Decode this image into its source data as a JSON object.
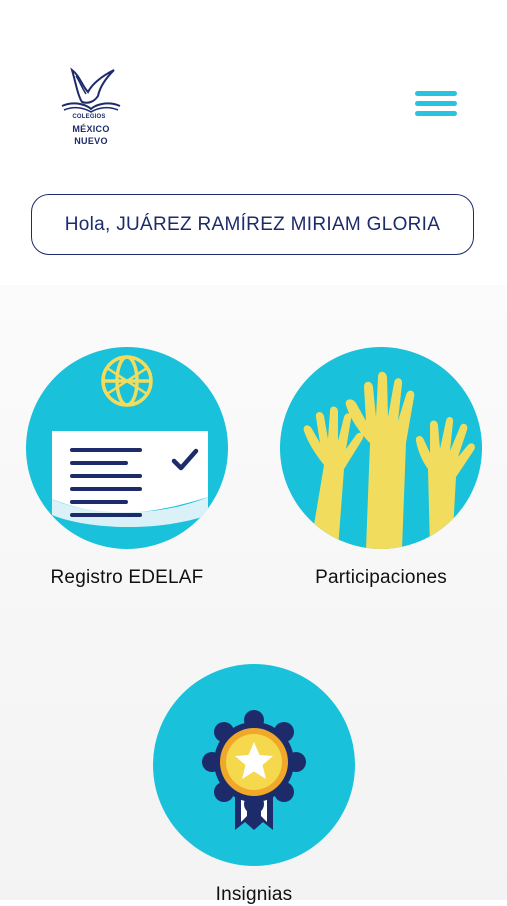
{
  "header": {
    "logo": {
      "small_text": "COLEGIOS",
      "line1": "MÉXICO",
      "line2": "NUEVO"
    },
    "menu_icon": "hamburger-menu-icon"
  },
  "greeting": {
    "text": "Hola, JUÁREZ RAMÍREZ MIRIAM GLORIA"
  },
  "tiles": [
    {
      "label": "Registro EDELAF",
      "icon": "registration-form-icon"
    },
    {
      "label": "Participaciones",
      "icon": "raised-hands-icon"
    },
    {
      "label": "Insignias",
      "icon": "badge-medal-icon"
    }
  ],
  "colors": {
    "primary_cyan": "#19c1da",
    "navy": "#1d2b6b",
    "yellow": "#f2dc5d"
  }
}
